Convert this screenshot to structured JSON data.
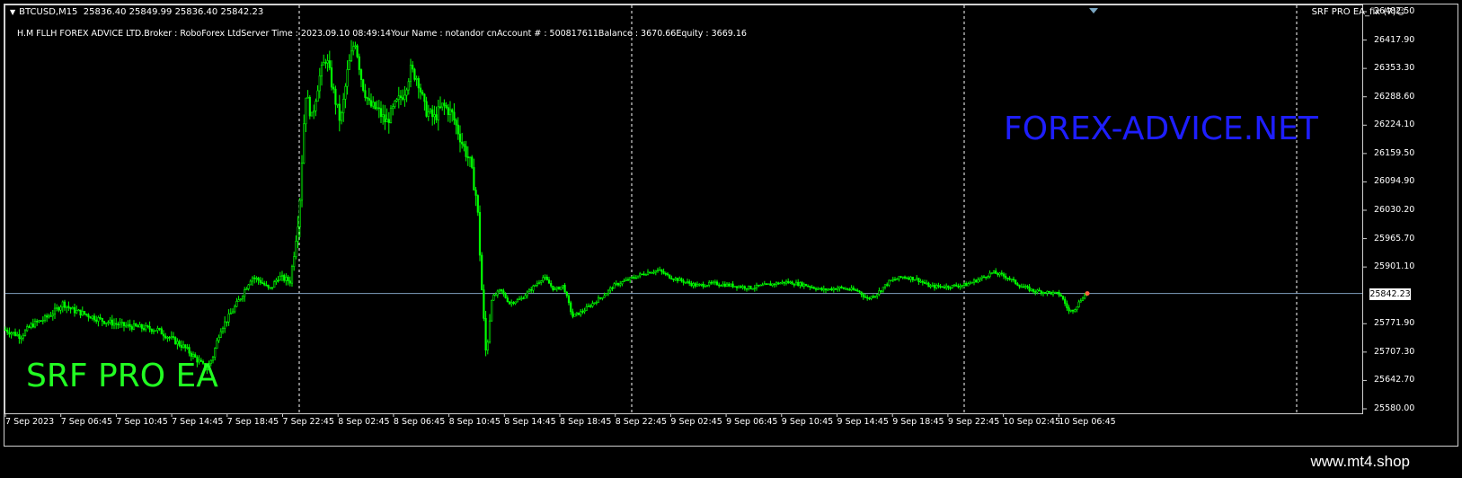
{
  "chart": {
    "symbol": "BTCUSD,M15",
    "ohlc": "25836.40 25849.99 25836.40 25842.23",
    "info_line": "H.M FLLH FOREX ADVICE LTD.Broker   : RoboForex LtdServer Time : 2023.09.10 08:49:14Your Name     : notandor cnAccount #   : 500817611Balance : 3670.66Equity     : 3669.16",
    "indicator_name": "SRF PRO EA_fix (7)",
    "indicator_icon": "smiley-icon",
    "watermark_right": "FOREX-ADVICE.NET",
    "watermark_left": "SRF PRO EA",
    "current_price": "25842.23",
    "price_labels": [
      "26482.50",
      "26417.90",
      "26353.30",
      "26288.60",
      "26224.10",
      "26159.50",
      "26094.90",
      "26030.20",
      "25965.70",
      "25901.10",
      "25771.90",
      "25707.30",
      "25642.70",
      "25580.00"
    ],
    "time_labels": [
      "7 Sep 2023",
      "7 Sep 06:45",
      "7 Sep 10:45",
      "7 Sep 14:45",
      "7 Sep 18:45",
      "7 Sep 22:45",
      "8 Sep 02:45",
      "8 Sep 06:45",
      "8 Sep 10:45",
      "8 Sep 14:45",
      "8 Sep 18:45",
      "8 Sep 22:45",
      "9 Sep 02:45",
      "9 Sep 06:45",
      "9 Sep 10:45",
      "9 Sep 14:45",
      "9 Sep 18:45",
      "9 Sep 22:45",
      "10 Sep 02:45",
      "10 Sep 06:45"
    ],
    "colors": {
      "candles": "#00ff00",
      "grid_period": "#ffffff",
      "price_line": "#7f9fbf",
      "watermark_right": "#1e1eff",
      "watermark_left": "#22ff22"
    }
  },
  "chart_data": {
    "type": "candlestick",
    "symbol": "BTCUSD",
    "timeframe": "M15",
    "ylim": [
      25580.0,
      26482.5
    ],
    "current_price": 25842.23,
    "path": [
      [
        0,
        25760
      ],
      [
        18,
        25745
      ],
      [
        30,
        25770
      ],
      [
        45,
        25785
      ],
      [
        55,
        25800
      ],
      [
        65,
        25820
      ],
      [
        75,
        25805
      ],
      [
        90,
        25795
      ],
      [
        110,
        25780
      ],
      [
        130,
        25770
      ],
      [
        150,
        25765
      ],
      [
        170,
        25760
      ],
      [
        185,
        25740
      ],
      [
        200,
        25720
      ],
      [
        215,
        25690
      ],
      [
        225,
        25670
      ],
      [
        232,
        25700
      ],
      [
        240,
        25760
      ],
      [
        250,
        25790
      ],
      [
        262,
        25830
      ],
      [
        275,
        25880
      ],
      [
        285,
        25870
      ],
      [
        295,
        25850
      ],
      [
        305,
        25880
      ],
      [
        318,
        25870
      ],
      [
        328,
        26030
      ],
      [
        335,
        26300
      ],
      [
        342,
        26240
      ],
      [
        350,
        26330
      ],
      [
        358,
        26380
      ],
      [
        366,
        26300
      ],
      [
        374,
        26230
      ],
      [
        382,
        26350
      ],
      [
        390,
        26420
      ],
      [
        398,
        26320
      ],
      [
        406,
        26270
      ],
      [
        415,
        26260
      ],
      [
        425,
        26230
      ],
      [
        435,
        26270
      ],
      [
        445,
        26300
      ],
      [
        452,
        26350
      ],
      [
        460,
        26330
      ],
      [
        468,
        26260
      ],
      [
        478,
        26240
      ],
      [
        488,
        26270
      ],
      [
        498,
        26250
      ],
      [
        510,
        26180
      ],
      [
        518,
        26140
      ],
      [
        526,
        26050
      ],
      [
        532,
        25820
      ],
      [
        536,
        25700
      ],
      [
        542,
        25830
      ],
      [
        552,
        25850
      ],
      [
        562,
        25820
      ],
      [
        575,
        25830
      ],
      [
        590,
        25860
      ],
      [
        600,
        25880
      ],
      [
        612,
        25850
      ],
      [
        622,
        25860
      ],
      [
        632,
        25790
      ],
      [
        642,
        25800
      ],
      [
        655,
        25820
      ],
      [
        668,
        25840
      ],
      [
        678,
        25860
      ],
      [
        690,
        25870
      ],
      [
        702,
        25880
      ],
      [
        715,
        25890
      ],
      [
        728,
        25895
      ],
      [
        740,
        25880
      ],
      [
        755,
        25870
      ],
      [
        770,
        25860
      ],
      [
        790,
        25865
      ],
      [
        810,
        25860
      ],
      [
        830,
        25855
      ],
      [
        850,
        25862
      ],
      [
        870,
        25868
      ],
      [
        890,
        25862
      ],
      [
        910,
        25850
      ],
      [
        930,
        25855
      ],
      [
        950,
        25848
      ],
      [
        960,
        25830
      ],
      [
        970,
        25840
      ],
      [
        985,
        25870
      ],
      [
        1000,
        25880
      ],
      [
        1015,
        25875
      ],
      [
        1030,
        25858
      ],
      [
        1050,
        25858
      ],
      [
        1070,
        25862
      ],
      [
        1085,
        25875
      ],
      [
        1100,
        25890
      ],
      [
        1115,
        25880
      ],
      [
        1130,
        25860
      ],
      [
        1145,
        25848
      ],
      [
        1160,
        25845
      ],
      [
        1175,
        25840
      ],
      [
        1185,
        25800
      ],
      [
        1192,
        25810
      ],
      [
        1200,
        25835
      ],
      [
        1205,
        25842
      ]
    ]
  }
}
